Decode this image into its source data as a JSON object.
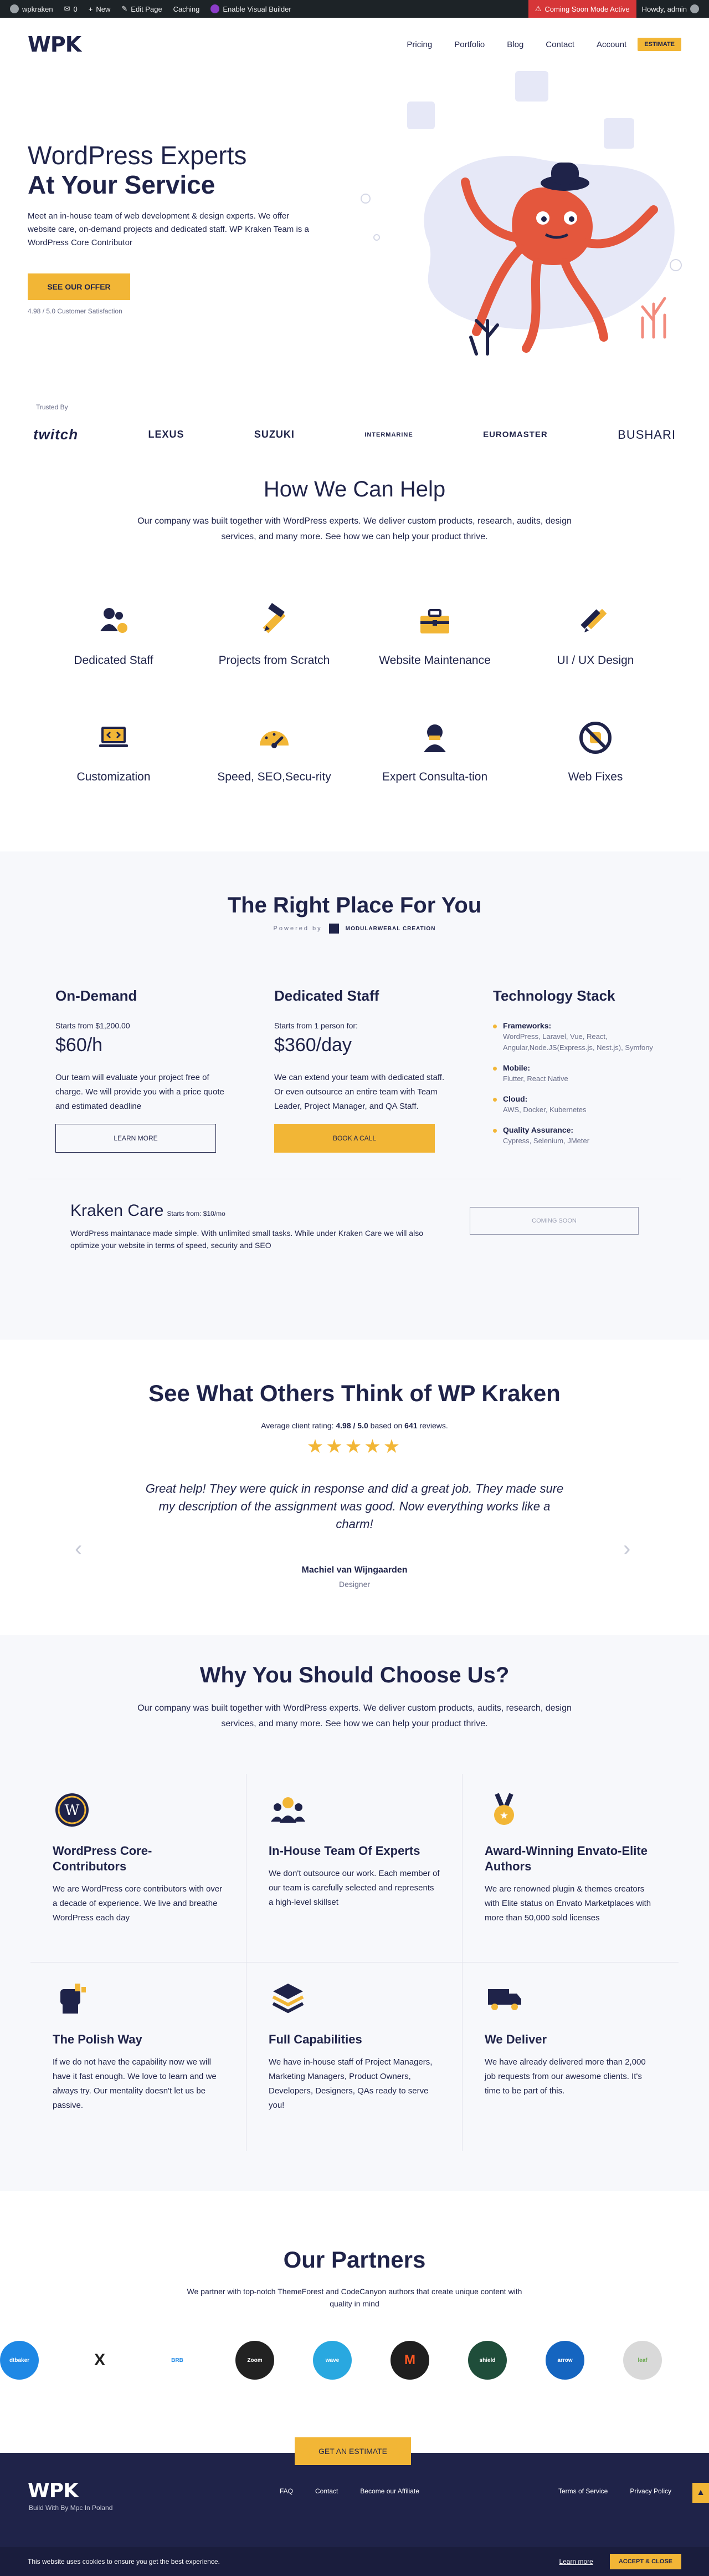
{
  "adminbar": {
    "site": "wpkraken",
    "comments": "0",
    "new": "New",
    "edit": "Edit Page",
    "caching": "Caching",
    "visual_builder": "Enable Visual Builder",
    "coming_soon": "Coming Soon Mode Active",
    "howdy": "Howdy, admin"
  },
  "header": {
    "logo": "WPK",
    "nav": [
      "Pricing",
      "Portfolio",
      "Blog",
      "Contact",
      "Account"
    ],
    "estimate": "ESTIMATE"
  },
  "hero": {
    "title1": "WordPress Experts",
    "title2": "At Your Service",
    "text": "Meet an in-house team of web development & design experts. We offer website care, on-demand projects and dedicated staff. WP Kraken Team is a WordPress Core Contributor",
    "button": "SEE OUR OFFER",
    "satisfaction": "4.98 / 5.0 Customer Satisfaction"
  },
  "trusted": {
    "label": "Trusted By",
    "brands": [
      "twitch",
      "LEXUS",
      "SUZUKI",
      "INTERMARINE",
      "EUROMASTER",
      "BUSHARI"
    ]
  },
  "help": {
    "title": "How We Can Help",
    "subtitle": "Our company was built together with WordPress experts. We deliver custom products, research, audits, design services, and many more. See how we can help your product thrive.",
    "items": [
      {
        "label": "Dedicated Staff",
        "icon": "team-icon"
      },
      {
        "label": "Projects from Scratch",
        "icon": "pencil-ruler-icon"
      },
      {
        "label": "Website Maintenance",
        "icon": "toolbox-icon"
      },
      {
        "label": "UI / UX Design",
        "icon": "design-tools-icon"
      },
      {
        "label": "Customization",
        "icon": "laptop-code-icon"
      },
      {
        "label": "Speed, SEO,Secu-rity",
        "icon": "speedometer-icon"
      },
      {
        "label": "Expert Consulta-tion",
        "icon": "consultant-icon"
      },
      {
        "label": "Web Fixes",
        "icon": "bug-fix-icon"
      }
    ]
  },
  "right_place": {
    "title": "The Right Place For You",
    "powered_by": "Powered by",
    "powered_brand": "MODULARWEBAL CREATION",
    "plans": [
      {
        "title": "On-Demand",
        "starts": "Starts from $1,200.00",
        "price": "$60/h",
        "text": "Our team will evaluate your project free of charge. We will provide you with a price quote and estimated deadline",
        "button": "LEARN MORE"
      },
      {
        "title": "Dedicated Staff",
        "starts": "Starts from 1 person for:",
        "price": "$360/day",
        "text": "We can extend your team with dedicated staff. Or even outsource an entire team with Team Leader, Project Manager, and QA Staff.",
        "button": "BOOK A CALL"
      }
    ],
    "stack": {
      "title": "Technology Stack",
      "items": [
        {
          "k": "Frameworks:",
          "v": "WordPress, Laravel, Vue, React, Angular,Node.JS(Express.js, Nest.js), Symfony"
        },
        {
          "k": "Mobile:",
          "v": "Flutter, React Native"
        },
        {
          "k": "Cloud:",
          "v": "AWS, Docker, Kubernetes"
        },
        {
          "k": "Quality Assurance:",
          "v": "Cypress, Selenium, JMeter"
        }
      ]
    },
    "care": {
      "title": "Kraken Care",
      "starts": "Starts from: $10/mo",
      "text": "WordPress maintanace made simple. With unlimited small tasks. While under Kraken Care we will also optimize your website in terms of speed, security and SEO",
      "button": "COMING SOON"
    }
  },
  "testimonials": {
    "title": "See What Others Think of WP Kraken",
    "rating_prefix": "Average client rating:",
    "rating": "4.98 / 5.0",
    "rating_mid": "based on",
    "reviews": "641",
    "rating_suffix": "reviews.",
    "stars": "★★★★★",
    "quote": "Great help! They were quick in response and did a great job. They made sure my description of the assignment was good. Now everything works like a charm!",
    "name": "Machiel van Wijngaarden",
    "role": "Designer",
    "prev": "‹",
    "next": "›"
  },
  "why": {
    "title": "Why You Should Choose Us?",
    "subtitle": "Our company was built together with WordPress experts. We deliver custom products, audits, research, design services, and many more. See how we can help your product thrive.",
    "items": [
      {
        "title": "WordPress Core-Contributors",
        "text": "We are WordPress core contributors with over a decade of experience. We live and breathe WordPress each day",
        "icon": "wordpress-icon"
      },
      {
        "title": "In-House Team Of Experts",
        "text": "We don't outsource our work. Each member of our team is carefully selected and represents a high-level skillset",
        "icon": "team-icon"
      },
      {
        "title": "Award-Winning Envato-Elite Authors",
        "text": "We are renowned plugin & themes creators with Elite status on Envato Marketplaces with more than 50,000 sold licenses",
        "icon": "award-medal-icon"
      },
      {
        "title": "The Polish Way",
        "text": "If we do not have the capability now we will have it fast enough. We love to learn and we always try. Our mentality doesn't let us be passive.",
        "icon": "fist-icon"
      },
      {
        "title": "Full Capabilities",
        "text": "We have in-house staff of Project Managers, Marketing Managers, Product Owners, Developers, Designers, QAs ready to serve you!",
        "icon": "layers-icon"
      },
      {
        "title": "We Deliver",
        "text": "We have already delivered more than 2,000 job requests from our awesome clients. It's time to be part of this.",
        "icon": "truck-icon"
      }
    ]
  },
  "partners": {
    "title": "Our Partners",
    "subtitle": "We partner with top-notch ThemeForest and CodeCanyon authors that create unique content with quality in mind",
    "logos": [
      {
        "name": "dtbaker",
        "color": "#1e88e5"
      },
      {
        "name": "X",
        "color": "#ffffff"
      },
      {
        "name": "BRB",
        "color": "#ffffff"
      },
      {
        "name": "Zoom",
        "color": "#222222"
      },
      {
        "name": "wave",
        "color": "#29a8e0"
      },
      {
        "name": "M",
        "color": "#1f1f1f"
      },
      {
        "name": "shield",
        "color": "#1f4d3a"
      },
      {
        "name": "arrow",
        "color": "#1565c0"
      },
      {
        "name": "leaf",
        "color": "#d9d9d9"
      }
    ],
    "cta": "GET AN ESTIMATE"
  },
  "footer": {
    "logo": "WPK",
    "tagline": "Build With By Mpc In Poland",
    "links": [
      "FAQ",
      "Contact",
      "Become our Affiliate"
    ],
    "links2": [
      "Terms of Service",
      "Privacy Policy"
    ],
    "totop": "▲"
  },
  "cookie": {
    "text": "This website uses cookies to ensure you get the best experience.",
    "learn": "Learn more",
    "accept": "ACCEPT & CLOSE"
  }
}
